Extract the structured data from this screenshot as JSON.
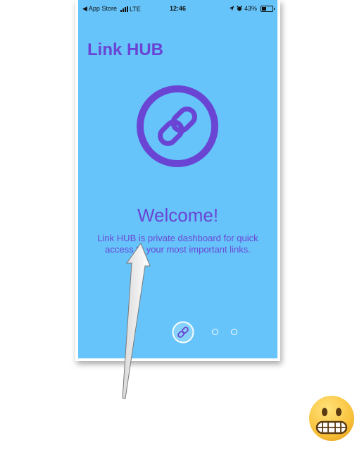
{
  "status_bar": {
    "back_label": "◀ App Store",
    "carrier": "LTE",
    "time": "12:46",
    "battery_percent": "43%",
    "battery_level": 0.43
  },
  "app": {
    "title": "Link HUB",
    "welcome_heading": "Welcome!",
    "description": "Link HUB is private dashboard for quick access to your most important links."
  },
  "pager": {
    "page_count": 3,
    "current_page": 1
  },
  "colors": {
    "screen_background": "#66c4fa",
    "accent_purple": "#6a45d4"
  },
  "annotations": {
    "arrow_icon": "arrow-up-icon",
    "emoji_icon": "grimacing-face-emoji"
  }
}
